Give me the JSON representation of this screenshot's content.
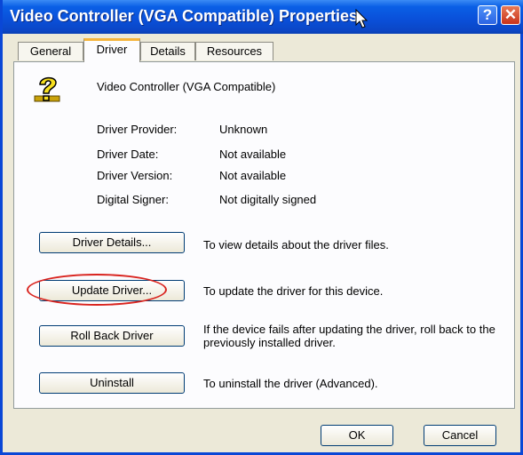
{
  "window": {
    "title": "Video Controller (VGA Compatible) Properties",
    "help_label": "?",
    "close_label": "✕"
  },
  "tabs": [
    {
      "label": "General"
    },
    {
      "label": "Driver",
      "active": true
    },
    {
      "label": "Details"
    },
    {
      "label": "Resources"
    }
  ],
  "device": {
    "name": "Video Controller (VGA Compatible)",
    "icon": "unknown-device-question-icon"
  },
  "info": [
    {
      "label": "Driver Provider:",
      "value": "Unknown"
    },
    {
      "label": "Driver Date:",
      "value": "Not available"
    },
    {
      "label": "Driver Version:",
      "value": "Not available"
    },
    {
      "label": "Digital Signer:",
      "value": "Not digitally signed"
    }
  ],
  "actions": [
    {
      "button": "Driver Details...",
      "description": "To view details about the driver files."
    },
    {
      "button": "Update Driver...",
      "description": "To update the driver for this device."
    },
    {
      "button": "Roll Back Driver",
      "description": "If the device fails after updating the driver, roll back to the previously installed driver."
    },
    {
      "button": "Uninstall",
      "description": "To uninstall the driver (Advanced)."
    }
  ],
  "footer": {
    "ok": "OK",
    "cancel": "Cancel"
  },
  "colors": {
    "titlebar": "#0a4fd8",
    "highlight_ellipse": "#d9241f",
    "dialog_bg": "#ece9d8"
  }
}
